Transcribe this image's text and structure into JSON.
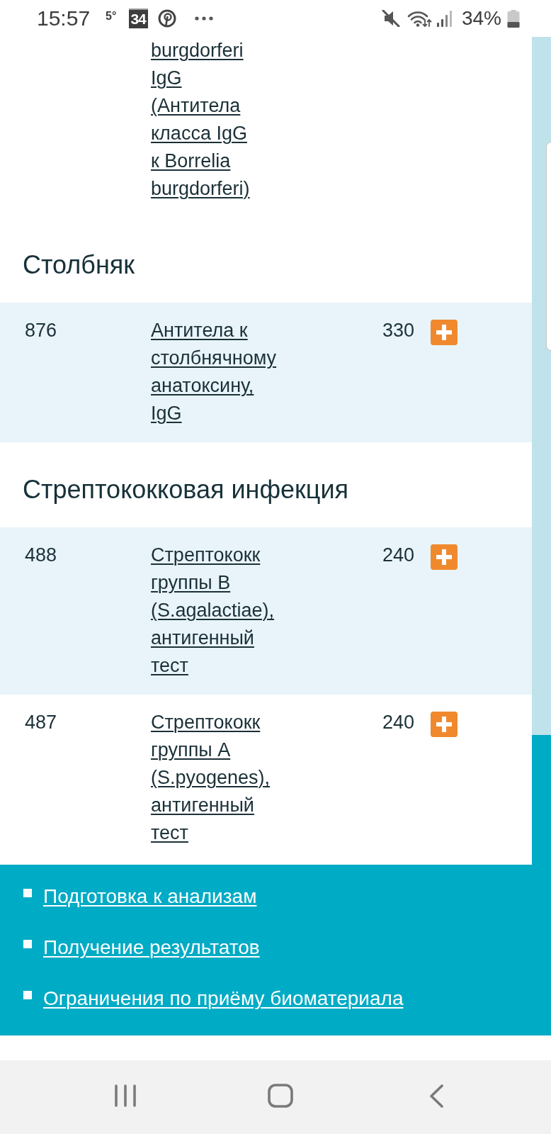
{
  "status_bar": {
    "time": "15:57",
    "temperature": "5°",
    "calendar_date": "34",
    "battery": "34%"
  },
  "sections": [
    {
      "rows": [
        {
          "name": "burgdorferi IgG (Антитела класса IgG к Borrelia burgdorferi)",
          "shaded": false
        }
      ]
    },
    {
      "title": "Столбняк",
      "rows": [
        {
          "code": "876",
          "name": "Антитела к столбнячному анатоксину, IgG",
          "price": "330",
          "shaded": true
        }
      ]
    },
    {
      "title": "Стрептококковая инфекция",
      "rows": [
        {
          "code": "488",
          "name": "Стрептококк группы B (S.agalactiae), антигенный тест",
          "price": "240",
          "shaded": true
        },
        {
          "code": "487",
          "name": "Стрептококк группы A (S.pyogenes), антигенный тест",
          "price": "240",
          "shaded": false
        }
      ]
    }
  ],
  "footer_links": [
    "Подготовка к анализам",
    "Получение результатов",
    "Ограничения по приёму биоматериала"
  ]
}
